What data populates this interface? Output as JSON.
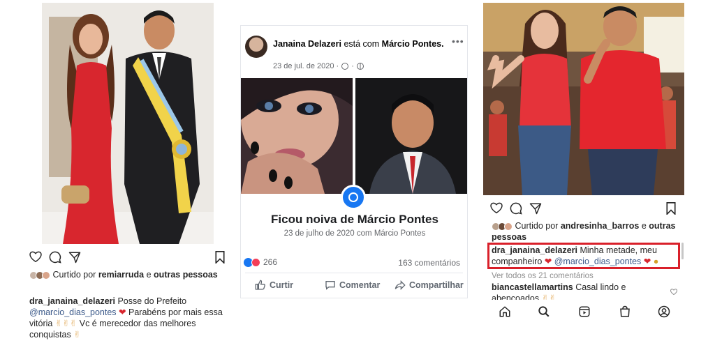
{
  "left": {
    "liked_by": "Curtido por",
    "liked_user": "remiarruda",
    "liked_and": "e",
    "liked_others": "outras pessoas",
    "username": "dra_janaina_delazeri",
    "caption_1": "Posse do Prefeito",
    "mention": "@marcio_dias_pontes",
    "caption_2": "Parabéns por mais essa vitória",
    "caption_3": "Vc é merecedor das melhores conquistas"
  },
  "middle": {
    "author": "Janaina Delazeri",
    "with_word": "está com",
    "tagged": "Márcio Pontes.",
    "date": "23 de jul. de 2020 ·",
    "event_title": "Ficou noiva de Márcio Pontes",
    "event_subtitle": "23 de julho de 2020 com Márcio Pontes",
    "reactions_count": "266",
    "comments_count": "163 comentários",
    "action_like": "Curtir",
    "action_comment": "Comentar",
    "action_share": "Compartilhar"
  },
  "right": {
    "liked_by": "Curtido por",
    "liked_user": "andresinha_barros",
    "liked_and": "e",
    "liked_others": "outras pessoas",
    "username": "dra_janaina_delazeri",
    "caption_1": "Minha metade, meu companheiro",
    "mention": "@marcio_dias_pontes",
    "view_comments": "Ver todos os 21 comentários",
    "comment_user": "biancastellamartins",
    "comment_text": "Casal lindo e abençoados"
  },
  "colors": {
    "highlight_box": "#d9202a",
    "dress_red": "#d8262e",
    "fb_blue": "#1877f2",
    "mention_blue": "#3c5a8a"
  }
}
